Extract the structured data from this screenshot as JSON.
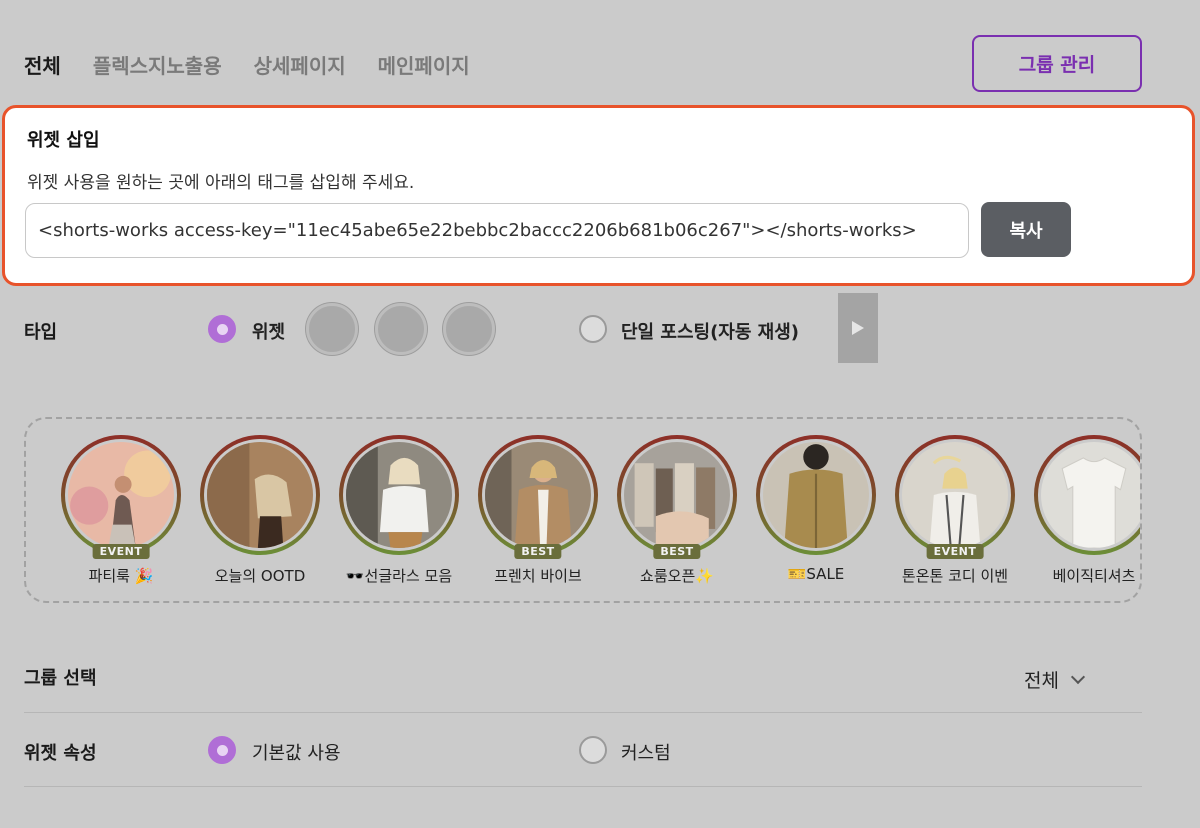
{
  "tabs": [
    {
      "label": "전체",
      "active": true
    },
    {
      "label": "플렉스지노출용",
      "active": false
    },
    {
      "label": "상세페이지",
      "active": false
    },
    {
      "label": "메인페이지",
      "active": false
    }
  ],
  "group_manage_label": "그룹 관리",
  "insert": {
    "title": "위젯 삽입",
    "description": "위젯 사용을 원하는 곳에 아래의 태그를 삽입해 주세요.",
    "code": "<shorts-works access-key=\"11ec45abe65e22bebbc2baccc2206b681b06c267\"></shorts-works>",
    "copy_label": "복사"
  },
  "type_row": {
    "label": "타입",
    "option_widget": "위젯",
    "option_single": "단일 포스팅(자동 재생)",
    "selected": "위젯"
  },
  "stories": [
    {
      "label": "파티룩 🎉",
      "badge": "EVENT"
    },
    {
      "label": "오늘의 OOTD",
      "badge": ""
    },
    {
      "label": "🕶️선글라스 모음",
      "badge": ""
    },
    {
      "label": "프렌치 바이브",
      "badge": "BEST"
    },
    {
      "label": "쇼룸오픈✨",
      "badge": "BEST"
    },
    {
      "label": "🎫SALE",
      "badge": ""
    },
    {
      "label": "톤온톤 코디 이벤",
      "badge": "EVENT"
    },
    {
      "label": "베이직티셔츠",
      "badge": ""
    }
  ],
  "group_select": {
    "label": "그룹 선택",
    "value": "전체"
  },
  "widget_attr": {
    "label": "위젯 속성",
    "option_default": "기본값 사용",
    "option_custom": "커스텀",
    "selected": "기본값 사용"
  },
  "colors": {
    "accent_purple": "#b06ed6",
    "group_button": "#7a2fb0",
    "highlight_border": "#e8532b",
    "copy_button": "#5b5e63"
  }
}
